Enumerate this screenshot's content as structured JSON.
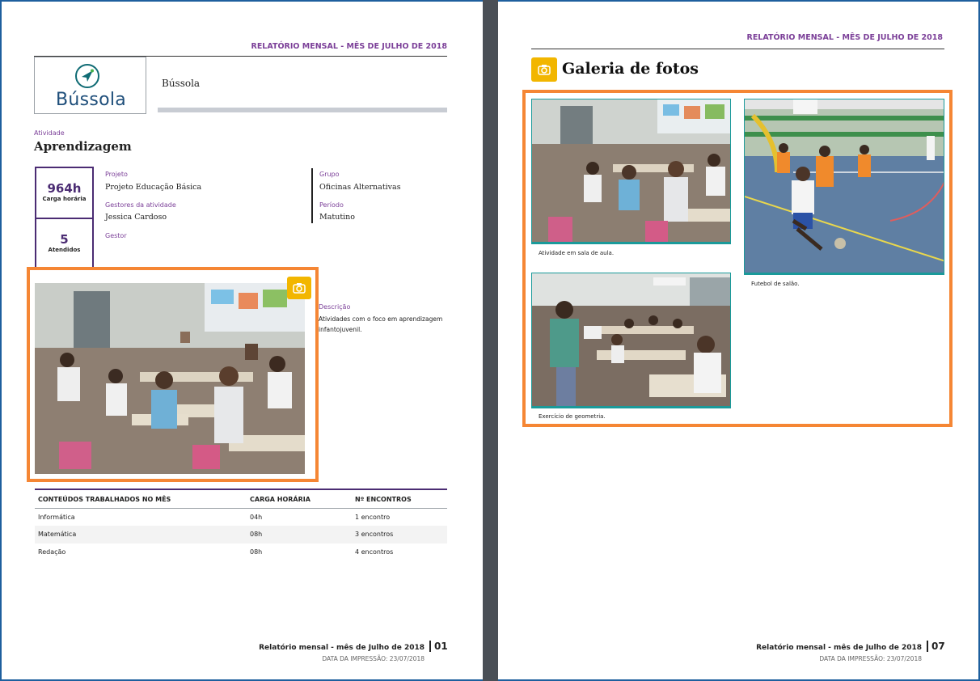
{
  "document": {
    "report_header": "RELATÓRIO MENSAL - MÊS DE JULHO DE 2018",
    "accent_color": "#7b3f98",
    "highlight_color": "#f58634"
  },
  "page1": {
    "logo_text": "Bússola",
    "organization": "Bússola",
    "activity_label": "Atividade",
    "activity_title": "Aprendizagem",
    "stats": [
      {
        "value": "964h",
        "label": "Carga horária"
      },
      {
        "value": "5",
        "label": "Atendidos"
      }
    ],
    "fields": {
      "projeto_label": "Projeto",
      "projeto_value": "Projeto Educação Básica",
      "gestores_label": "Gestores da atividade",
      "gestores_value": "Jessica Cardoso",
      "gestor_label": "Gestor",
      "grupo_label": "Grupo",
      "grupo_value": "Oficinas Alternativas",
      "periodo_label": "Período",
      "periodo_value": "Matutino",
      "descricao_label": "Descrição",
      "descricao_value": "Atividades com o foco em aprendizagem infantojuvenil."
    },
    "photo_icon": "camera-icon",
    "table": {
      "headers": [
        "CONTEÚDOS TRABALHADOS NO MÊS",
        "CARGA HORÁRIA",
        "Nº ENCONTROS"
      ],
      "rows": [
        [
          "Informática",
          "04h",
          "1 encontro"
        ],
        [
          "Matemática",
          "08h",
          "3 encontros"
        ],
        [
          "Redação",
          "08h",
          "4 encontros"
        ]
      ]
    },
    "footer": {
      "title": "Relatório mensal - mês de Julho de 2018",
      "date": "DATA DA IMPRESSÃO: 23/07/2018",
      "page_number": "01"
    }
  },
  "page2": {
    "gallery_icon": "camera-icon",
    "gallery_title": "Galeria de fotos",
    "captions": [
      "Atividade em sala de aula.",
      "Futebol de salão.",
      "Exercício de geometria."
    ],
    "footer": {
      "title": "Relatório mensal - mês de Julho de 2018",
      "date": "DATA DA IMPRESSÃO: 23/07/2018",
      "page_number": "07"
    }
  }
}
